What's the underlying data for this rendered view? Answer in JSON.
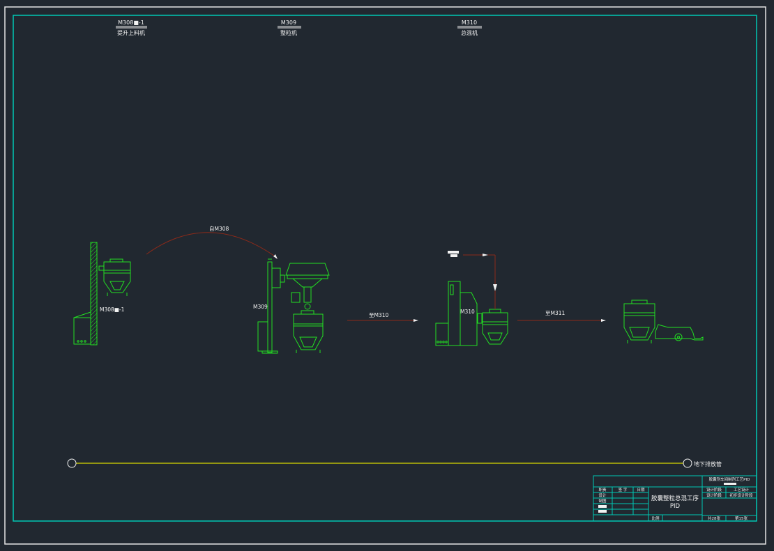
{
  "colors": {
    "background": "#212830",
    "outer_frame": "#e6e6e6",
    "inner_frame": "#00c8b4",
    "equipment": "#22e022",
    "process_line": "#8a2a1a",
    "drain_line": "#d8d800",
    "text": "#f2f2f2"
  },
  "headers": [
    {
      "tag": "M308■-1",
      "name": "提升上料机"
    },
    {
      "tag": "M309",
      "name": "整粒机"
    },
    {
      "tag": "M310",
      "name": "总混机"
    }
  ],
  "equipment_labels": {
    "lifter": "M308■-1",
    "granulator": "M309",
    "mixer": "M310"
  },
  "flow_labels": {
    "from_m308": "自M308",
    "to_m310": "至M310",
    "to_m311": "至M311"
  },
  "drain_label": "地下排放管",
  "title_block": {
    "project": "胶囊剂车间制剂工艺PID",
    "drawing_title_line1": "胶囊整粒总混工序",
    "drawing_title_line2": "PID",
    "stage_label": "设计阶段",
    "stage_value": "工艺设计",
    "phase_label": "设计阶段",
    "phase_value": "初步设计阶段",
    "roles": [
      "职责",
      "签 字",
      "日期"
    ],
    "rows": [
      "设计",
      "制图"
    ],
    "scale_label": "比例",
    "total_sheets": "共28张",
    "sheet_no": "第15张"
  }
}
